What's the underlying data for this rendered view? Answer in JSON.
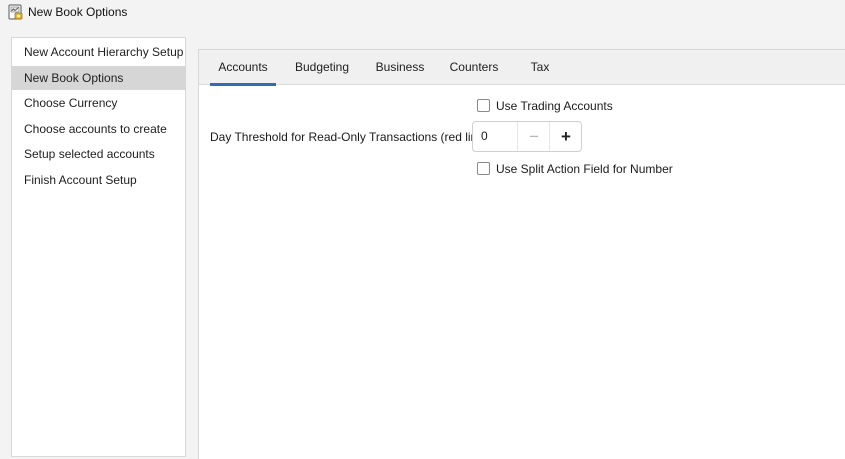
{
  "window": {
    "title": "New Book Options"
  },
  "sidebar": {
    "items": [
      {
        "label": "New Account Hierarchy Setup"
      },
      {
        "label": "New Book Options"
      },
      {
        "label": "Choose Currency"
      },
      {
        "label": "Choose accounts to create"
      },
      {
        "label": "Setup selected accounts"
      },
      {
        "label": "Finish Account Setup"
      }
    ],
    "selected": "New Book Options"
  },
  "tabs": [
    {
      "label": "Accounts"
    },
    {
      "label": "Budgeting"
    },
    {
      "label": "Business"
    },
    {
      "label": "Counters"
    },
    {
      "label": "Tax"
    }
  ],
  "active_tab": "Accounts",
  "accounts": {
    "use_trading_accounts": {
      "label": "Use Trading Accounts",
      "checked": false
    },
    "day_threshold": {
      "label": "Day Threshold for Read-Only Transactions (red line)",
      "value": "0",
      "minus": "−",
      "plus": "+"
    },
    "use_split_action": {
      "label": "Use Split Action Field for Number",
      "checked": false
    }
  },
  "icons": {
    "app": "gnucash-book-icon",
    "accent_color": "#2f6db5"
  }
}
